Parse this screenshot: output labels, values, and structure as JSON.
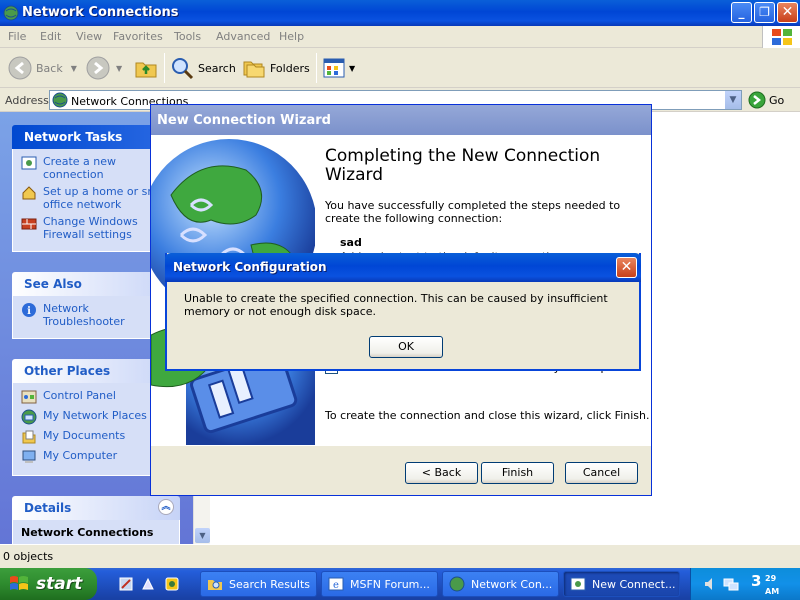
{
  "window": {
    "title": "Network Connections"
  },
  "menu": [
    "File",
    "Edit",
    "View",
    "Favorites",
    "Tools",
    "Advanced",
    "Help"
  ],
  "toolbar": {
    "back_label": "Back",
    "search_label": "Search",
    "folders_label": "Folders"
  },
  "address": {
    "label": "Address",
    "value": "Network Connections",
    "go_label": "Go"
  },
  "taskpane": {
    "network_tasks": {
      "title": "Network Tasks",
      "items": [
        "Create a new connection",
        "Set up a home or small office network",
        "Change Windows Firewall settings"
      ]
    },
    "see_also": {
      "title": "See Also",
      "items": [
        "Network Troubleshooter"
      ]
    },
    "other_places": {
      "title": "Other Places",
      "items": [
        "Control Panel",
        "My Network Places",
        "My Documents",
        "My Computer"
      ]
    },
    "details": {
      "title": "Details",
      "subtitle": "Network Connections"
    }
  },
  "status": {
    "text": "0 objects"
  },
  "wizard": {
    "title": "New Connection Wizard",
    "heading": "Completing the New Connection Wizard",
    "intro": "You have successfully completed the steps needed to create the following connection:",
    "connection_name": "sad",
    "sub_text": "Add a shortcut to the default connection",
    "checkbox_label": "Add a shortcut to this connection to my desktop",
    "finish_text": "To create the connection and close this wizard, click Finish.",
    "back_label": "< Back",
    "finish_label": "Finish",
    "cancel_label": "Cancel"
  },
  "dialog": {
    "title": "Network Configuration",
    "message": "Unable to create the specified connection.  This can be caused by insufficient memory or not enough disk space.",
    "ok_label": "OK"
  },
  "taskbar": {
    "start_label": "start",
    "tasks": [
      "Search Results",
      "MSFN Forum...",
      "Network Con...",
      "New Connect..."
    ],
    "clock_hour": "3",
    "clock_min": "29",
    "clock_ampm": "AM"
  },
  "colors": {
    "xp_blue": "#0046d5",
    "taskpane_link": "#215dc6",
    "start_green": "#2e8b2e"
  }
}
